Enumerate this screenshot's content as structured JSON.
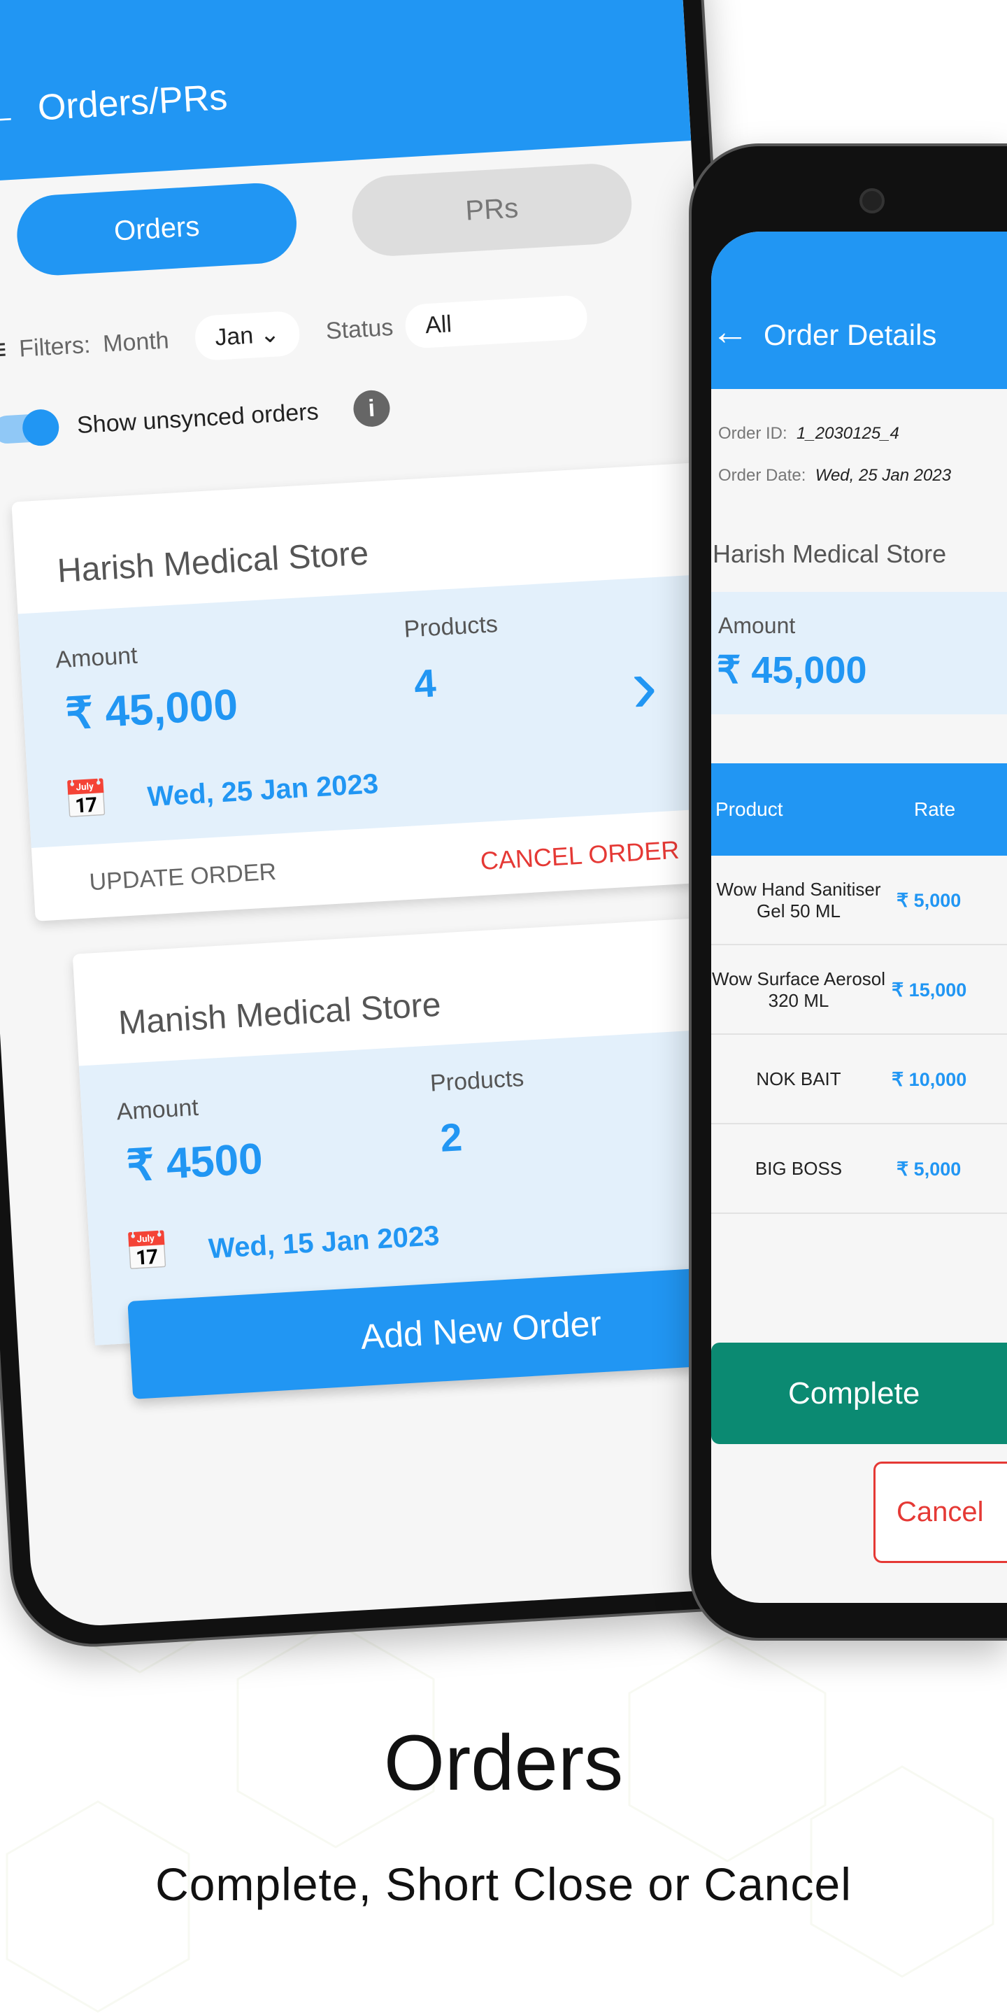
{
  "colors": {
    "primary": "#2196f3",
    "light_blue": "#e3f0fb",
    "complete_green": "#0b8a72",
    "danger": "#e53935"
  },
  "orders_screen": {
    "title": "Orders/PRs",
    "back_icon": "arrow-left-icon",
    "tabs": [
      {
        "label": "Orders",
        "active": true
      },
      {
        "label": "PRs",
        "active": false
      }
    ],
    "filters": {
      "label": "Filters:",
      "month_label": "Month",
      "month_value": "Jan",
      "status_label": "Status",
      "status_value": "All"
    },
    "unsynced": {
      "label": "Show unsynced orders",
      "enabled": true
    },
    "orders": [
      {
        "store": "Harish Medical Store",
        "amount_label": "Amount",
        "amount": "₹ 45,000",
        "products_label": "Products",
        "products": "4",
        "date": "Wed, 25 Jan 2023",
        "update_label": "UPDATE ORDER",
        "cancel_label": "CANCEL ORDER"
      },
      {
        "store": "Manish Medical Store",
        "amount_label": "Amount",
        "amount": "₹ 4500",
        "products_label": "Products",
        "products": "2",
        "date": "Wed, 15 Jan 2023"
      }
    ],
    "add_button": "Add New Order"
  },
  "details_screen": {
    "title": "Order Details",
    "order_id_label": "Order ID:",
    "order_id": "1_2030125_4",
    "order_date_label": "Order Date:",
    "order_date": "Wed, 25 Jan 2023",
    "store": "Harish Medical Store",
    "amount_label": "Amount",
    "amount": "₹ 45,000",
    "columns": [
      "Product",
      "Rate"
    ],
    "rows": [
      {
        "product": "Wow Hand Sanitiser Gel 50 ML",
        "rate": "₹ 5,000"
      },
      {
        "product": "Wow Surface Aerosol 320 ML",
        "rate": "₹ 15,000"
      },
      {
        "product": "NOK BAIT",
        "rate": "₹ 10,000"
      },
      {
        "product": "BIG BOSS",
        "rate": "₹ 5,000"
      }
    ],
    "complete_button": "Complete",
    "cancel_button": "Cancel"
  },
  "caption": {
    "title": "Orders",
    "subtitle": "Complete, Short Close or Cancel"
  }
}
